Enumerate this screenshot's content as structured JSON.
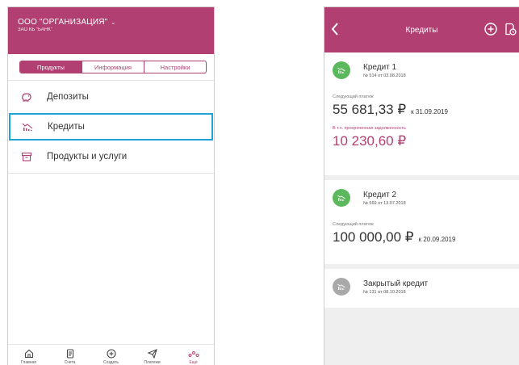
{
  "left_screen": {
    "org_name": "ООО \"ОРГАНИЗАЦИЯ\"",
    "bank_name": "ЗАО КБ \"БАНК\"",
    "tabs": [
      {
        "label": "Продукты",
        "active": true
      },
      {
        "label": "Информация",
        "active": false
      },
      {
        "label": "Настройки",
        "active": false
      }
    ],
    "menu": [
      {
        "label": "Депозиты",
        "icon": "piggy-bank-icon"
      },
      {
        "label": "Кредиты",
        "icon": "credit-chart-icon",
        "selected": true
      },
      {
        "label": "Продукты и услуги",
        "icon": "box-icon"
      }
    ],
    "bottom_nav": [
      {
        "label": "Главная",
        "icon": "home-icon"
      },
      {
        "label": "Счета",
        "icon": "document-icon"
      },
      {
        "label": "Создать",
        "icon": "plus-circle-icon"
      },
      {
        "label": "Платежи",
        "icon": "paper-plane-icon"
      },
      {
        "label": "Ещё",
        "icon": "more-dots-icon",
        "active": true
      }
    ]
  },
  "right_screen": {
    "title": "Кредиты",
    "credits": [
      {
        "name": "Кредит 1",
        "number": "№ 514 от 03.08.2018",
        "status_color": "#5cb85c",
        "payment_label": "Следующий платеж",
        "payment_amount": "55 681,33 ₽",
        "payment_due": "к 31.09.2019",
        "overdue_label": "В т.ч. просроченная задолженность",
        "overdue_amount": "10 230,60 ₽"
      },
      {
        "name": "Кредит 2",
        "number": "№ 569 от 13.07.2018",
        "status_color": "#5cb85c",
        "payment_label": "Следующий платеж",
        "payment_amount": "100 000,00 ₽",
        "payment_due": "к 20.09.2019"
      },
      {
        "name": "Закрытый кредит",
        "number": "№ 131 от 08.10.2018",
        "status_color": "#a9a9a9"
      }
    ]
  },
  "colors": {
    "brand": "#b13f72",
    "highlight": "#1fa2d9",
    "active_green": "#5cb85c",
    "closed_gray": "#a9a9a9"
  }
}
